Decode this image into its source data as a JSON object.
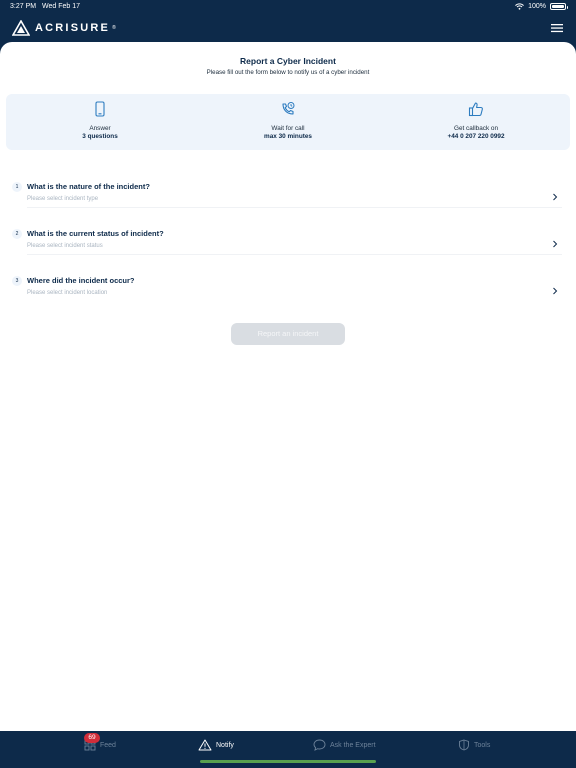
{
  "status_bar": {
    "time": "3:27 PM",
    "date": "Wed Feb 17",
    "battery": "100%"
  },
  "header": {
    "logo_text": "ACRISURE",
    "logo_mark": "®"
  },
  "page": {
    "title": "Report a Cyber Incident",
    "subtitle": "Please fill out the form below to notify us of a cyber incident"
  },
  "info": [
    {
      "icon": "phone-icon",
      "line1": "Answer",
      "line2": "3 questions"
    },
    {
      "icon": "phone-call-icon",
      "line1": "Wait for call",
      "line2": "max 30 minutes"
    },
    {
      "icon": "thumbs-up-icon",
      "line1": "Get callback on",
      "line2": "+44 0 207 220 0992"
    }
  ],
  "questions": [
    {
      "number": "1",
      "title": "What is the nature of the incident?",
      "placeholder": "Please select incident type"
    },
    {
      "number": "2",
      "title": "What is the current status of incident?",
      "placeholder": "Please select incident status"
    },
    {
      "number": "3",
      "title": "Where did the incident occur?",
      "placeholder": "Please select incident location"
    }
  ],
  "submit_label": "Report an incident",
  "tabs": [
    {
      "label": "Feed",
      "icon": "grid-icon",
      "badge": "69"
    },
    {
      "label": "Notify",
      "icon": "warning-icon"
    },
    {
      "label": "Ask the Expert",
      "icon": "chat-bubble-icon"
    },
    {
      "label": "Tools",
      "icon": "shield-icon"
    }
  ],
  "colors": {
    "navy": "#0d2a4a",
    "panel": "#eef4fb",
    "badge": "#d12d3a",
    "indicator": "#59a14f",
    "disabled_button": "#d9dde2"
  }
}
